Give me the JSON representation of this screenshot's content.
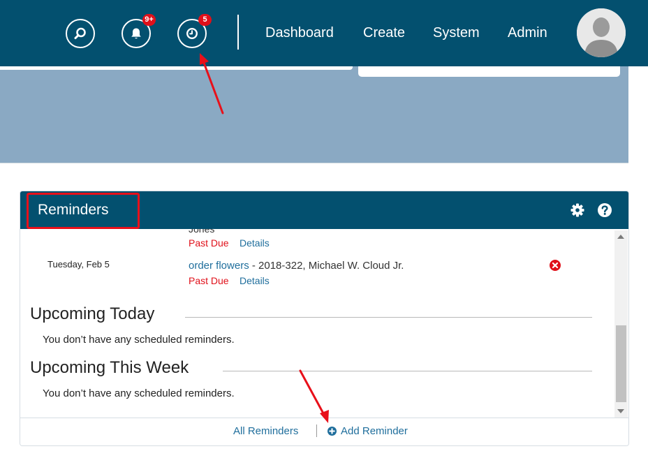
{
  "header": {
    "search_icon": "search-icon",
    "notifications": {
      "icon": "bell-icon",
      "badge": "9+"
    },
    "reminders": {
      "icon": "clock-icon",
      "badge": "5"
    },
    "nav": [
      {
        "label": "Dashboard"
      },
      {
        "label": "Create"
      },
      {
        "label": "System"
      },
      {
        "label": "Admin"
      }
    ],
    "avatar_icon": "user-avatar-icon"
  },
  "widget": {
    "title": "Reminders",
    "settings_icon": "gear-icon",
    "help_icon": "help-icon",
    "partial_text": "Jones",
    "reminders": [
      {
        "status": "Past Due",
        "details": "Details"
      },
      {
        "date": "Tuesday, Feb 5",
        "title": "order flowers",
        "info": " - 2018-322, Michael W. Cloud Jr.",
        "status": "Past Due",
        "details": "Details",
        "delete_icon": "delete-x-icon"
      }
    ],
    "sections": [
      {
        "title": "Upcoming Today",
        "empty": "You don’t have any scheduled reminders."
      },
      {
        "title": "Upcoming This Week",
        "empty": "You don’t have any scheduled reminders."
      }
    ],
    "footer": {
      "all_label": "All Reminders",
      "add_label": "Add Reminder",
      "add_icon": "plus-circle-icon"
    }
  },
  "colors": {
    "brand": "#03506f",
    "banner": "#8aa9c3",
    "link": "#1f6e9c",
    "alert": "#e0101a",
    "annotation": "#e8101a"
  }
}
